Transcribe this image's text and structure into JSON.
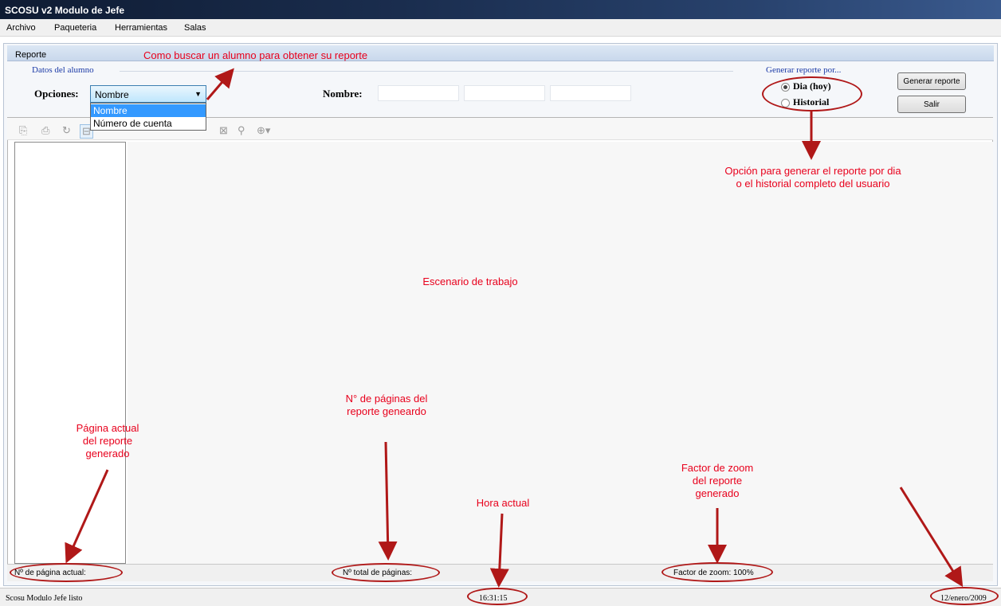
{
  "window": {
    "title": "SCOSU v2 Modulo de Jefe"
  },
  "menu": {
    "items": [
      "Archivo",
      "Paqueteria",
      "Herramientas",
      "Salas"
    ]
  },
  "report_window": {
    "title": "Reporte"
  },
  "student_group": {
    "title": "Datos del alumno",
    "options_label": "Opciones:",
    "selected_option": "Nombre",
    "dropdown_options": [
      "Nombre",
      "Número de cuenta"
    ],
    "name_label": "Nombre:"
  },
  "report_type_group": {
    "title": "Generar reporte por...",
    "options": [
      {
        "label": "Dia (hoy)",
        "checked": true
      },
      {
        "label": "Historial",
        "checked": false
      }
    ]
  },
  "buttons": {
    "generate": "Generar reporte",
    "exit": "Salir"
  },
  "viewer_toolbar": {
    "icons": [
      "export-icon",
      "print-icon",
      "refresh-icon",
      "group-tree-icon",
      "close-icon",
      "find-icon",
      "zoom-icon"
    ]
  },
  "viewer_status": {
    "current_page": "Nº de página actual:",
    "total_pages": "Nº total de páginas:",
    "zoom": "Factor de zoom: 100%"
  },
  "app_status": {
    "message": "Scosu Modulo Jefe listo",
    "time": "16:31:15",
    "date": "12/enero/2009"
  },
  "annotations": {
    "search": "Como buscar un alumno para obtener su reporte",
    "report_option": [
      "Opción para generar el reporte por dia",
      "o el historial completo del usuario"
    ],
    "workspace": "Escenario de trabajo",
    "pages": [
      "N° de páginas del",
      "reporte geneardo"
    ],
    "current_page": [
      "Página actual",
      "del reporte",
      "generado"
    ],
    "time": "Hora actual",
    "zoom": [
      "Factor de zoom",
      "del reporte",
      "generado"
    ]
  },
  "colors": {
    "annotation": "#e8001c",
    "group_title": "#1a39a6",
    "selection": "#3399ff"
  }
}
